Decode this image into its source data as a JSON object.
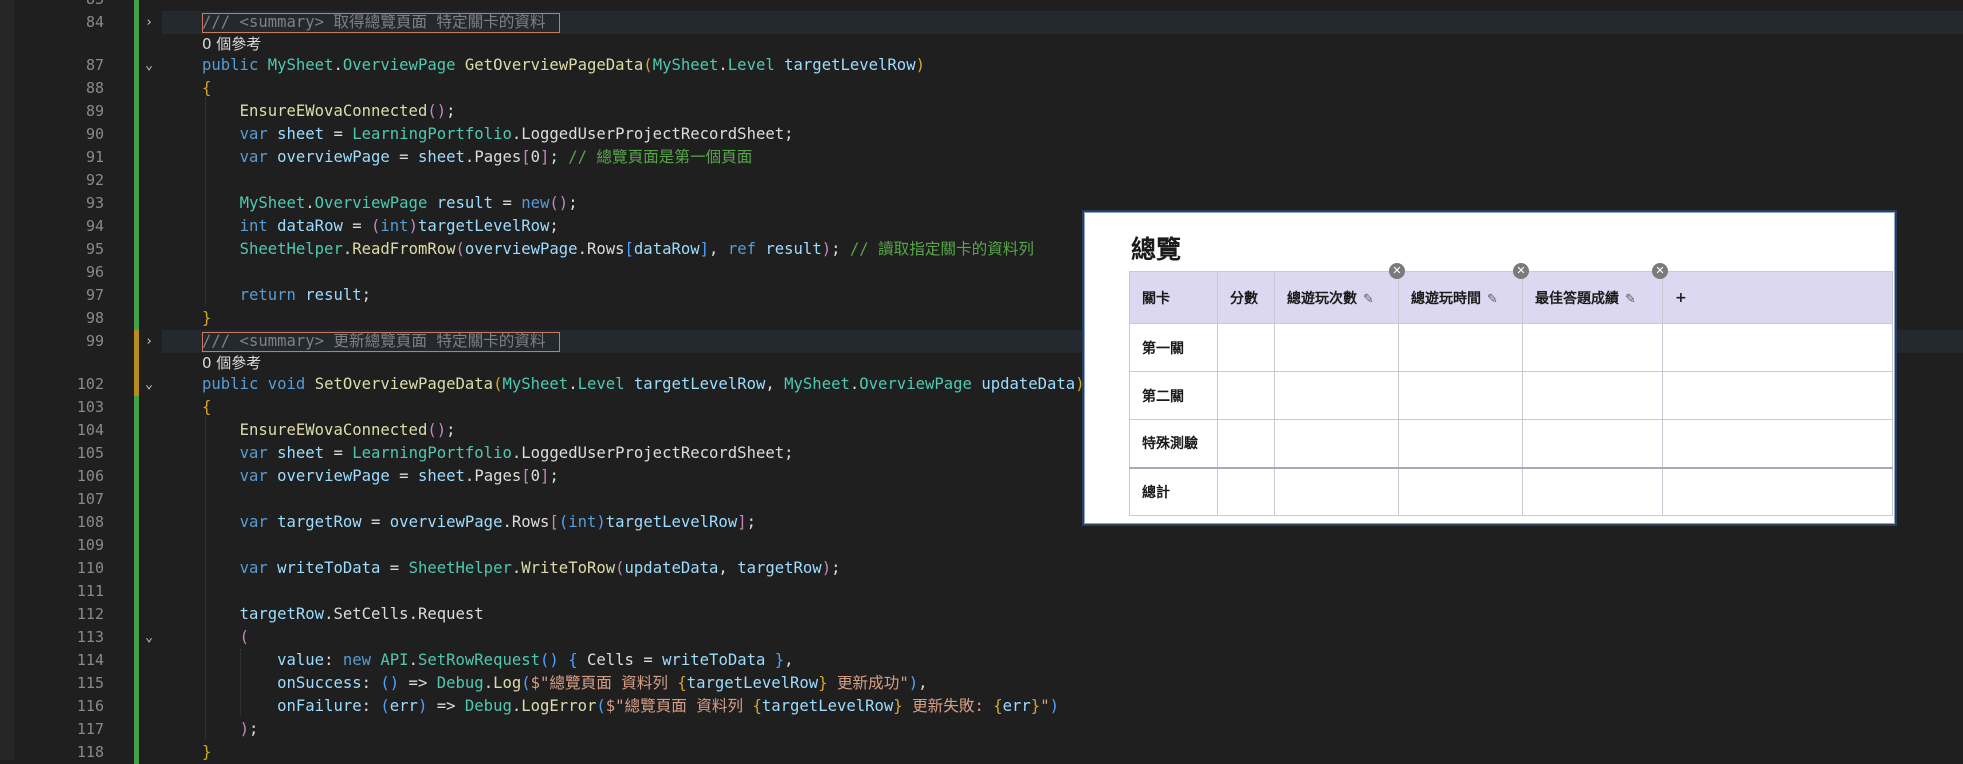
{
  "editor": {
    "line_numbers": [
      "83",
      "84",
      "87",
      "88",
      "89",
      "90",
      "91",
      "92",
      "93",
      "94",
      "95",
      "96",
      "97",
      "98",
      "99",
      "102",
      "103",
      "104",
      "105",
      "106",
      "107",
      "108",
      "109",
      "110",
      "111",
      "112",
      "113",
      "114",
      "115",
      "116",
      "117",
      "118"
    ],
    "summary1": "/// <summary> 取得總覽頁面 特定關卡的資料",
    "refs1": "0 個參考",
    "summary2": "/// <summary> 更新總覽頁面 特定關卡的資料",
    "refs2": "0 個參考",
    "method1_signature": {
      "kw": "public",
      "ns": "MySheet",
      "type": "OverviewPage",
      "name": "GetOverviewPageData",
      "ptype_ns": "MySheet",
      "ptype": "Level",
      "pname": "targetLevelRow"
    },
    "l89": "EnsureEWovaConnected",
    "l90": {
      "kw": "var",
      "v": "sheet",
      "cls": "LearningPortfolio",
      "prop": "LoggedUserProjectRecordSheet"
    },
    "l91": {
      "kw": "var",
      "v": "overviewPage",
      "src": "sheet",
      "prop": "Pages",
      "idx": "0",
      "comment": "// 總覽頁面是第一個頁面"
    },
    "l93": {
      "ns": "MySheet",
      "type": "OverviewPage",
      "v": "result",
      "kw": "new"
    },
    "l94": {
      "kw": "int",
      "v": "dataRow",
      "cast": "int",
      "arg": "targetLevelRow"
    },
    "l95": {
      "cls": "SheetHelper",
      "m": "ReadFromRow",
      "a1": "overviewPage",
      "a1p": "Rows",
      "a1i": "dataRow",
      "ref": "ref",
      "a2": "result",
      "comment": "// 讀取指定關卡的資料列"
    },
    "l97": {
      "kw": "return",
      "v": "result"
    },
    "method2_signature": {
      "kw": "public",
      "kw2": "void",
      "name": "SetOverviewPageData",
      "ptype_ns": "MySheet",
      "ptype": "Level",
      "pname": "targetLevelRow",
      "p2type_ns": "MySheet",
      "p2type": "OverviewPage",
      "p2name": "updateData"
    },
    "l104": "EnsureEWovaConnected",
    "l105": {
      "kw": "var",
      "v": "sheet",
      "cls": "LearningPortfolio",
      "prop": "LoggedUserProjectRecordSheet"
    },
    "l106": {
      "kw": "var",
      "v": "overviewPage",
      "src": "sheet",
      "prop": "Pages",
      "idx": "0"
    },
    "l108": {
      "kw": "var",
      "v": "targetRow",
      "src": "overviewPage",
      "prop": "Rows",
      "cast": "int",
      "arg": "targetLevelRow"
    },
    "l110": {
      "kw": "var",
      "v": "writeToData",
      "cls": "SheetHelper",
      "m": "WriteToRow",
      "a1": "updateData",
      "a2": "targetRow"
    },
    "l112": {
      "v": "targetRow",
      "p1": "SetCells",
      "m": "Request"
    },
    "l114": {
      "label": "value",
      "kw": "new",
      "ns": "API",
      "type": "SetRowRequest",
      "prop": "Cells",
      "v": "writeToData"
    },
    "l115": {
      "label": "onSuccess",
      "cls": "Debug",
      "m": "Log",
      "s1": "$\"總覽頁面 資料列 ",
      "interp": "targetLevelRow",
      "s2": " 更新成功\""
    },
    "l116": {
      "label": "onFailure",
      "param": "err",
      "cls": "Debug",
      "m": "LogError",
      "s1": "$\"總覽頁面 資料列 ",
      "interp": "targetLevelRow",
      "s2": " 更新失敗: ",
      "interp2": "err",
      "s3": "\""
    }
  },
  "overview": {
    "title": "總覽",
    "headers": [
      "關卡",
      "分數",
      "總遊玩次數",
      "總遊玩時間",
      "最佳答題成績",
      "+"
    ],
    "rows": [
      "第一關",
      "第二關",
      "特殊測驗"
    ],
    "total_label": "總計",
    "edit_icon": "✎",
    "delete_icon": "✕"
  }
}
